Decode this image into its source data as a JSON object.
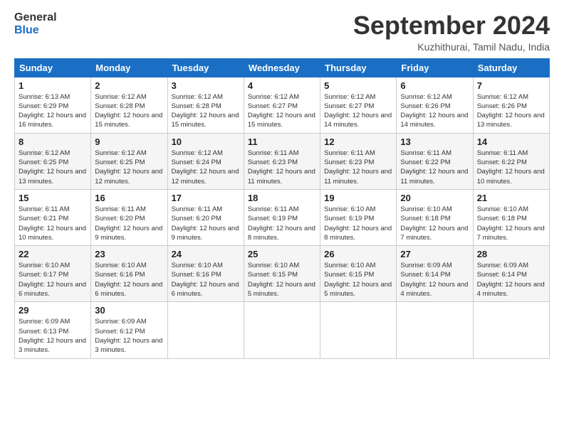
{
  "logo": {
    "line1": "General",
    "line2": "Blue"
  },
  "title": "September 2024",
  "subtitle": "Kuzhithurai, Tamil Nadu, India",
  "weekdays": [
    "Sunday",
    "Monday",
    "Tuesday",
    "Wednesday",
    "Thursday",
    "Friday",
    "Saturday"
  ],
  "weeks": [
    [
      {
        "day": "1",
        "sunrise": "6:13 AM",
        "sunset": "6:29 PM",
        "daylight": "12 hours and 16 minutes."
      },
      {
        "day": "2",
        "sunrise": "6:12 AM",
        "sunset": "6:28 PM",
        "daylight": "12 hours and 15 minutes."
      },
      {
        "day": "3",
        "sunrise": "6:12 AM",
        "sunset": "6:28 PM",
        "daylight": "12 hours and 15 minutes."
      },
      {
        "day": "4",
        "sunrise": "6:12 AM",
        "sunset": "6:27 PM",
        "daylight": "12 hours and 15 minutes."
      },
      {
        "day": "5",
        "sunrise": "6:12 AM",
        "sunset": "6:27 PM",
        "daylight": "12 hours and 14 minutes."
      },
      {
        "day": "6",
        "sunrise": "6:12 AM",
        "sunset": "6:26 PM",
        "daylight": "12 hours and 14 minutes."
      },
      {
        "day": "7",
        "sunrise": "6:12 AM",
        "sunset": "6:26 PM",
        "daylight": "12 hours and 13 minutes."
      }
    ],
    [
      {
        "day": "8",
        "sunrise": "6:12 AM",
        "sunset": "6:25 PM",
        "daylight": "12 hours and 13 minutes."
      },
      {
        "day": "9",
        "sunrise": "6:12 AM",
        "sunset": "6:25 PM",
        "daylight": "12 hours and 12 minutes."
      },
      {
        "day": "10",
        "sunrise": "6:12 AM",
        "sunset": "6:24 PM",
        "daylight": "12 hours and 12 minutes."
      },
      {
        "day": "11",
        "sunrise": "6:11 AM",
        "sunset": "6:23 PM",
        "daylight": "12 hours and 11 minutes."
      },
      {
        "day": "12",
        "sunrise": "6:11 AM",
        "sunset": "6:23 PM",
        "daylight": "12 hours and 11 minutes."
      },
      {
        "day": "13",
        "sunrise": "6:11 AM",
        "sunset": "6:22 PM",
        "daylight": "12 hours and 11 minutes."
      },
      {
        "day": "14",
        "sunrise": "6:11 AM",
        "sunset": "6:22 PM",
        "daylight": "12 hours and 10 minutes."
      }
    ],
    [
      {
        "day": "15",
        "sunrise": "6:11 AM",
        "sunset": "6:21 PM",
        "daylight": "12 hours and 10 minutes."
      },
      {
        "day": "16",
        "sunrise": "6:11 AM",
        "sunset": "6:20 PM",
        "daylight": "12 hours and 9 minutes."
      },
      {
        "day": "17",
        "sunrise": "6:11 AM",
        "sunset": "6:20 PM",
        "daylight": "12 hours and 9 minutes."
      },
      {
        "day": "18",
        "sunrise": "6:11 AM",
        "sunset": "6:19 PM",
        "daylight": "12 hours and 8 minutes."
      },
      {
        "day": "19",
        "sunrise": "6:10 AM",
        "sunset": "6:19 PM",
        "daylight": "12 hours and 8 minutes."
      },
      {
        "day": "20",
        "sunrise": "6:10 AM",
        "sunset": "6:18 PM",
        "daylight": "12 hours and 7 minutes."
      },
      {
        "day": "21",
        "sunrise": "6:10 AM",
        "sunset": "6:18 PM",
        "daylight": "12 hours and 7 minutes."
      }
    ],
    [
      {
        "day": "22",
        "sunrise": "6:10 AM",
        "sunset": "6:17 PM",
        "daylight": "12 hours and 6 minutes."
      },
      {
        "day": "23",
        "sunrise": "6:10 AM",
        "sunset": "6:16 PM",
        "daylight": "12 hours and 6 minutes."
      },
      {
        "day": "24",
        "sunrise": "6:10 AM",
        "sunset": "6:16 PM",
        "daylight": "12 hours and 6 minutes."
      },
      {
        "day": "25",
        "sunrise": "6:10 AM",
        "sunset": "6:15 PM",
        "daylight": "12 hours and 5 minutes."
      },
      {
        "day": "26",
        "sunrise": "6:10 AM",
        "sunset": "6:15 PM",
        "daylight": "12 hours and 5 minutes."
      },
      {
        "day": "27",
        "sunrise": "6:09 AM",
        "sunset": "6:14 PM",
        "daylight": "12 hours and 4 minutes."
      },
      {
        "day": "28",
        "sunrise": "6:09 AM",
        "sunset": "6:14 PM",
        "daylight": "12 hours and 4 minutes."
      }
    ],
    [
      {
        "day": "29",
        "sunrise": "6:09 AM",
        "sunset": "6:13 PM",
        "daylight": "12 hours and 3 minutes."
      },
      {
        "day": "30",
        "sunrise": "6:09 AM",
        "sunset": "6:12 PM",
        "daylight": "12 hours and 3 minutes."
      },
      null,
      null,
      null,
      null,
      null
    ]
  ]
}
